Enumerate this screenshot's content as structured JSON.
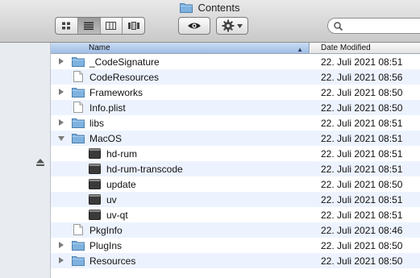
{
  "window": {
    "title": "Contents"
  },
  "toolbar": {
    "view_buttons": [
      {
        "name": "icon-view-button",
        "icon": "grid-icon"
      },
      {
        "name": "list-view-button",
        "icon": "list-icon",
        "active": true
      },
      {
        "name": "column-view-button",
        "icon": "columns-icon"
      },
      {
        "name": "coverflow-view-button",
        "icon": "coverflow-icon"
      }
    ],
    "quicklook_icon": "eye-icon",
    "action_icon": "gear-icon",
    "search_icon": "search-icon"
  },
  "sidebar": {
    "eject_icon": "eject-icon"
  },
  "list": {
    "columns": {
      "name": "Name",
      "date": "Date Modified"
    },
    "rows": [
      {
        "name": "_CodeSignature",
        "date": "22. Juli 2021 08:51",
        "kind": "folder",
        "disclosure": "closed",
        "indent": 0
      },
      {
        "name": "CodeResources",
        "date": "22. Juli 2021 08:56",
        "kind": "file",
        "disclosure": "none",
        "indent": 0
      },
      {
        "name": "Frameworks",
        "date": "22. Juli 2021 08:50",
        "kind": "folder",
        "disclosure": "closed",
        "indent": 0
      },
      {
        "name": "Info.plist",
        "date": "22. Juli 2021 08:50",
        "kind": "file",
        "disclosure": "none",
        "indent": 0
      },
      {
        "name": "libs",
        "date": "22. Juli 2021 08:51",
        "kind": "folder",
        "disclosure": "closed",
        "indent": 0
      },
      {
        "name": "MacOS",
        "date": "22. Juli 2021 08:51",
        "kind": "folder",
        "disclosure": "open",
        "indent": 0
      },
      {
        "name": "hd-rum",
        "date": "22. Juli 2021 08:51",
        "kind": "exec",
        "disclosure": "none",
        "indent": 1
      },
      {
        "name": "hd-rum-transcode",
        "date": "22. Juli 2021 08:51",
        "kind": "exec",
        "disclosure": "none",
        "indent": 1
      },
      {
        "name": "update",
        "date": "22. Juli 2021 08:50",
        "kind": "exec",
        "disclosure": "none",
        "indent": 1
      },
      {
        "name": "uv",
        "date": "22. Juli 2021 08:51",
        "kind": "exec",
        "disclosure": "none",
        "indent": 1
      },
      {
        "name": "uv-qt",
        "date": "22. Juli 2021 08:51",
        "kind": "exec",
        "disclosure": "none",
        "indent": 1
      },
      {
        "name": "PkgInfo",
        "date": "22. Juli 2021 08:46",
        "kind": "file",
        "disclosure": "none",
        "indent": 0
      },
      {
        "name": "PlugIns",
        "date": "22. Juli 2021 08:50",
        "kind": "folder",
        "disclosure": "closed",
        "indent": 0
      },
      {
        "name": "Resources",
        "date": "22. Juli 2021 08:50",
        "kind": "folder",
        "disclosure": "closed",
        "indent": 0
      }
    ]
  },
  "colors": {
    "folder": "#7fb2df",
    "selected_header": "#a9c5ea",
    "alt_row": "#edf3fe",
    "exec_icon": "#3a3a3a"
  }
}
